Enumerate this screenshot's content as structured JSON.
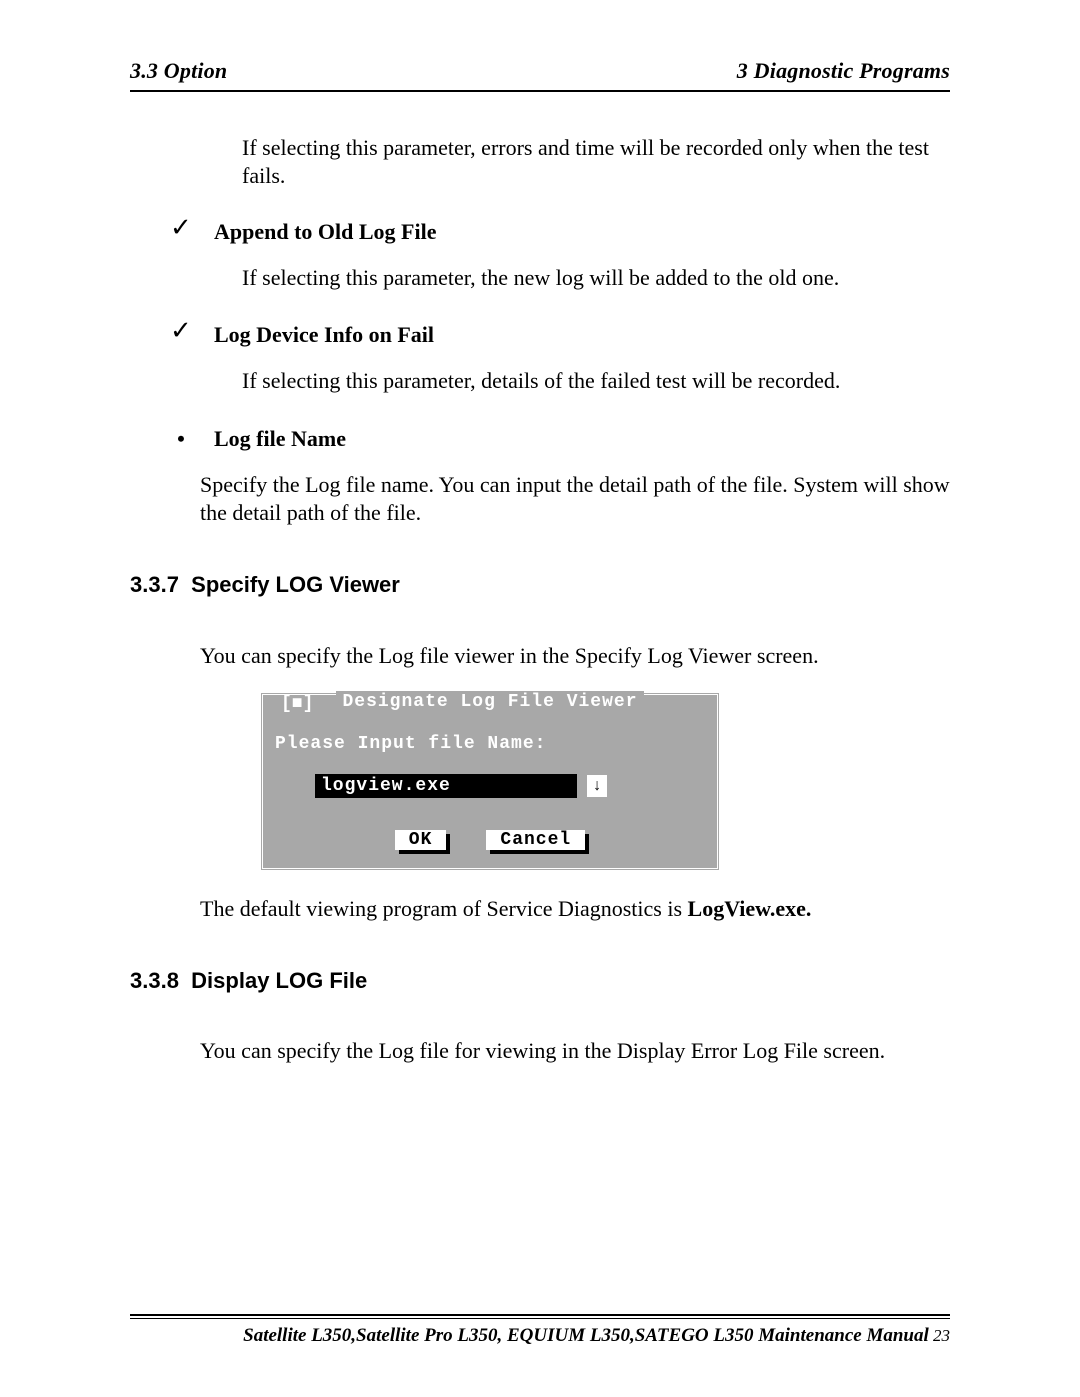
{
  "header": {
    "left": "3.3 Option",
    "right": "3  Diagnostic Programs"
  },
  "intro_para": "If selecting this parameter, errors and time will be recorded only when the test fails.",
  "check1": {
    "title": "Append to Old Log File",
    "desc": "If selecting this parameter, the new log will be added to the old one."
  },
  "check2": {
    "title": "Log Device Info on Fail",
    "desc": "If selecting this parameter, details of the failed test will be recorded."
  },
  "bullet1": {
    "title": "Log file Name",
    "desc": "Specify the Log file name. You can input the detail path of the file. System will show the detail path of the file."
  },
  "section337": {
    "num": "3.3.7",
    "title": "Specify LOG Viewer",
    "lead": "You can specify the Log file viewer in the Specify Log Viewer screen.",
    "after_prefix": "The default viewing program of Service Diagnostics is ",
    "after_bold": "LogView.exe."
  },
  "dialog": {
    "close_glyph": "[■]",
    "title": "Designate Log File Viewer",
    "label": "Please Input file Name:",
    "input_value": "logview.exe",
    "down_arrow": "↓",
    "ok": "OK",
    "cancel": "Cancel"
  },
  "section338": {
    "num": "3.3.8",
    "title": "Display LOG File",
    "lead": "You can specify the Log file for viewing in the Display Error Log File screen."
  },
  "footer": {
    "text": "Satellite L350,Satellite Pro L350, EQUIUM L350,SATEGO L350 Maintenance Manual",
    "page": " 23"
  }
}
